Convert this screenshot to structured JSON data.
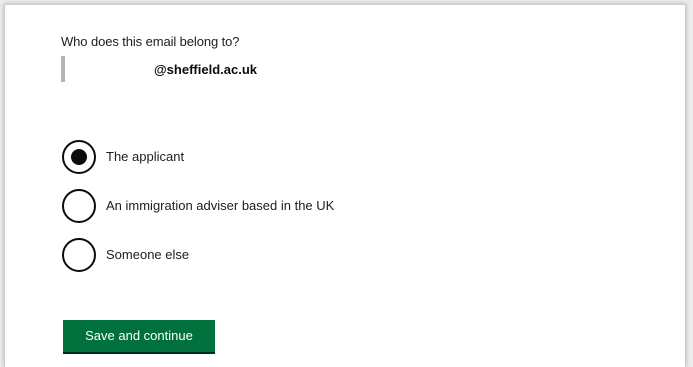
{
  "question": {
    "label": "Who does this email belong to?",
    "email_value": "@sheffield.ac.uk"
  },
  "options": [
    {
      "label": "The applicant",
      "selected": true
    },
    {
      "label": "An immigration adviser based in the UK",
      "selected": false
    },
    {
      "label": "Someone else",
      "selected": false
    }
  ],
  "actions": {
    "save_label": "Save and continue"
  },
  "colors": {
    "button_green": "#00703c",
    "text": "#0b0c0c",
    "inset_border": "#b1b4b6"
  }
}
